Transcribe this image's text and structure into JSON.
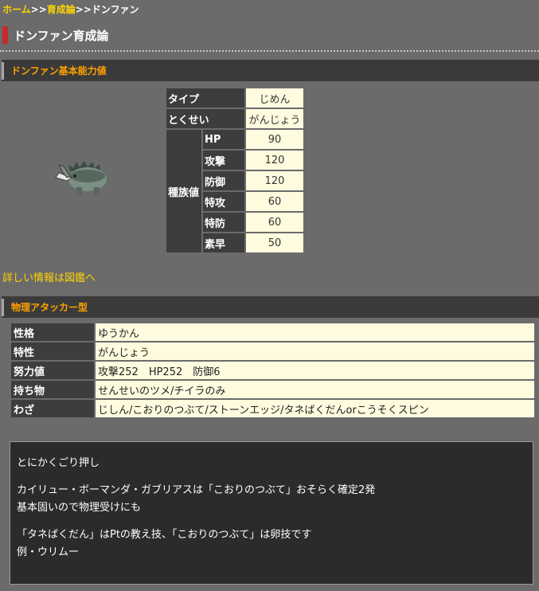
{
  "breadcrumb": {
    "home": "ホーム",
    "sep1": ">>",
    "guide": "育成論",
    "sep2": ">>",
    "current": "ドンファン"
  },
  "page_title": "ドンファン育成論",
  "base_section": {
    "title": "ドンファン基本能力値",
    "type_label": "タイプ",
    "type_value": "じめん",
    "ability_label": "とくせい",
    "ability_value": "がんじょう",
    "stats_label": "種族値",
    "stats": [
      {
        "name": "HP",
        "value": "90"
      },
      {
        "name": "攻撃",
        "value": "120"
      },
      {
        "name": "防御",
        "value": "120"
      },
      {
        "name": "特攻",
        "value": "60"
      },
      {
        "name": "特防",
        "value": "60"
      },
      {
        "name": "素早",
        "value": "50"
      }
    ],
    "detail_link": "詳しい情報は図鑑へ"
  },
  "build": {
    "title": "物理アタッカー型",
    "rows": [
      {
        "label": "性格",
        "value": "ゆうかん"
      },
      {
        "label": "特性",
        "value": "がんじょう"
      },
      {
        "label": "努力値",
        "value": "攻撃252　HP252　防御6"
      },
      {
        "label": "持ち物",
        "value": "せんせいのツメ/チイラのみ"
      },
      {
        "label": "わざ",
        "value": "じしん/こおりのつぶて/ストーンエッジ/タネばくだんorこうそくスピン"
      }
    ]
  },
  "comment": {
    "p1": "とにかくごり押し",
    "p2": "カイリュー・ボーマンダ・ガブリアスは「こおりのつぶて」おそらく確定2発\n基本固いので物理受けにも",
    "p3": "「タネばくだん」はPtの教え技、「こおりのつぶて」は卵技です\n例・ウリムー"
  },
  "colors": {
    "accent_orange": "#ffa200",
    "link_yellow": "#ffd400",
    "title_red": "#c62a2a",
    "cell_cream": "#fffbdf"
  }
}
